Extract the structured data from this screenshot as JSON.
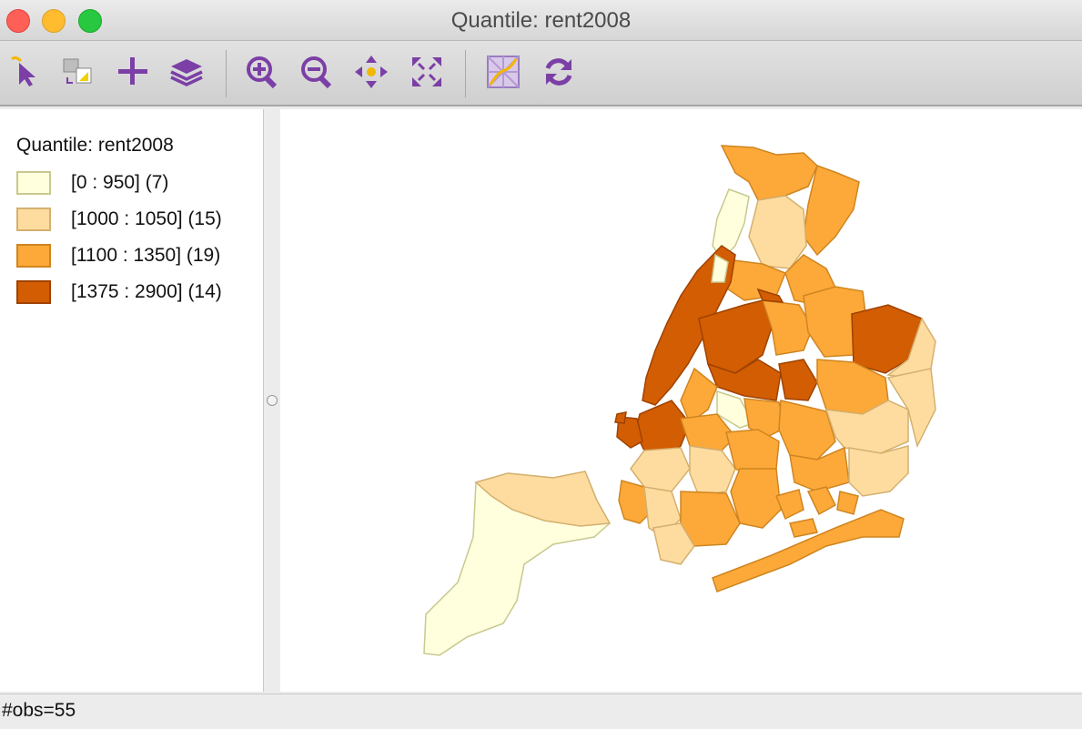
{
  "window": {
    "title": "Quantile: rent2008"
  },
  "toolbar": {
    "tools": [
      {
        "name": "select-tool-icon"
      },
      {
        "name": "selection-shape-icon"
      },
      {
        "name": "add-icon"
      },
      {
        "name": "layers-icon"
      },
      {
        "name": "zoom-in-icon"
      },
      {
        "name": "zoom-out-icon"
      },
      {
        "name": "pan-icon"
      },
      {
        "name": "fit-extent-icon"
      },
      {
        "name": "basemap-icon"
      },
      {
        "name": "refresh-icon"
      }
    ],
    "icon_color": "#7b3fa6"
  },
  "legend": {
    "title": "Quantile: rent2008",
    "items": [
      {
        "label": "[0 : 950] (7)",
        "color": "#ffffdd",
        "border": "#c8c890"
      },
      {
        "label": "[1000 : 1050] (15)",
        "color": "#fedc9f",
        "border": "#d4b070"
      },
      {
        "label": "[1100 : 1350] (19)",
        "color": "#fda939",
        "border": "#cf8520"
      },
      {
        "label": "[1375 : 2900] (14)",
        "color": "#d35d02",
        "border": "#9e4200"
      }
    ]
  },
  "status": {
    "text": "#obs=55"
  }
}
